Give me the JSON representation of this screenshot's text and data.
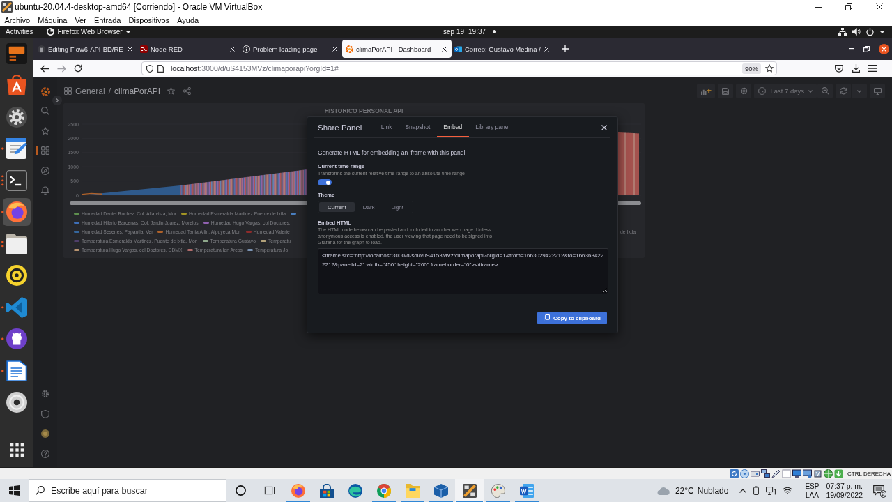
{
  "vbox": {
    "title": "ubuntu-20.04.4-desktop-amd64 [Corriendo] - Oracle VM VirtualBox",
    "menu": [
      "Archivo",
      "Máquina",
      "Ver",
      "Entrada",
      "Dispositivos",
      "Ayuda"
    ],
    "host_key": "CTRL DERECHA"
  },
  "ubuntu_bar": {
    "activities": "Activities",
    "app_menu": "Firefox Web Browser",
    "date": "sep 19",
    "time": "19:37"
  },
  "dock": [
    {
      "kind": "retro-term",
      "selected": false
    },
    {
      "kind": "software",
      "selected": false
    },
    {
      "kind": "settings",
      "selected": false
    },
    {
      "kind": "text-editor",
      "selected": false,
      "windows": [
        {
          "kind": "window"
        }
      ]
    },
    {
      "kind": "terminal",
      "selected": false,
      "windows": [
        {
          "kind": "window"
        },
        {
          "kind": "window"
        },
        {
          "kind": "window"
        }
      ]
    },
    {
      "kind": "firefox",
      "selected": true,
      "windows": [
        {
          "kind": "window"
        }
      ]
    },
    {
      "kind": "files",
      "selected": false,
      "windows": [
        {
          "kind": "window"
        },
        {
          "kind": "window"
        }
      ]
    },
    {
      "kind": "rhythmbox",
      "selected": false
    },
    {
      "kind": "vscode",
      "selected": false,
      "windows": [
        {
          "kind": "window"
        }
      ]
    },
    {
      "kind": "github",
      "selected": false,
      "windows": [
        {
          "kind": "window"
        }
      ]
    },
    {
      "kind": "writer",
      "selected": false,
      "windows": [
        {
          "kind": "window"
        }
      ]
    },
    {
      "kind": "disc",
      "selected": false
    },
    {
      "kind": "apps",
      "selected": false
    }
  ],
  "firefox": {
    "tabs": [
      {
        "kind": "github",
        "title": "Editing Flow6-API-BD/RE",
        "selected": false
      },
      {
        "kind": "node-red",
        "title": "Node-RED",
        "selected": false
      },
      {
        "kind": "info",
        "title": "Problem loading page",
        "selected": false
      },
      {
        "kind": "grafana",
        "title": "climaPorAPI - Dashboard",
        "selected": true
      },
      {
        "kind": "outlook",
        "title": "Correo: Gustavo Medina /",
        "selected": false
      }
    ],
    "url_host": "localhost",
    "url_path": ":3000/d/uS4153MVz/climaporapi?orgId=1#",
    "zoom": "90%"
  },
  "grafana": {
    "sidebar_top": [
      {
        "kind": "search",
        "selected": false
      },
      {
        "kind": "starred",
        "selected": false
      },
      {
        "kind": "dashboards",
        "selected": true
      },
      {
        "kind": "explore",
        "selected": false
      },
      {
        "kind": "alerting",
        "selected": false
      }
    ],
    "sidebar_bottom": [
      {
        "kind": "configuration",
        "selected": false
      },
      {
        "kind": "server-admin",
        "selected": false
      },
      {
        "kind": "profile",
        "selected": false
      },
      {
        "kind": "help",
        "selected": false
      }
    ],
    "breadcrumb": {
      "folder": "General",
      "separator": "/",
      "title": "climaPorAPI"
    },
    "time_picker": "Last 7 days",
    "panel": {
      "title": "HISTORICO PERSONAL API",
      "y_ticks": [
        "2500",
        "2000",
        "1500",
        "1000",
        "500",
        "0"
      ],
      "legend": [
        [
          {
            "kind": "series",
            "label": "Humedad Daniel Rochez. Col. Alta vista, Mor",
            "color": "#5e8f4e"
          },
          {
            "kind": "series",
            "label": "Humedad Esmeralda Martinez Puente de Ixtla",
            "color": "#a39524"
          },
          {
            "kind": "series",
            "color": "#4a7fc0"
          }
        ],
        [
          {
            "kind": "series",
            "label": "Humedad Hilario Barcenas. Col. Jardin Juarez, Morelos",
            "color": "#3e6fb8"
          },
          {
            "kind": "series",
            "label": "Humedad Hugo Vargas, col Doctores.",
            "color": "#9061b0"
          }
        ],
        [
          {
            "kind": "series",
            "label": "Humedad Sesenes. Papantla, Ver",
            "color": "#35679e"
          },
          {
            "kind": "series",
            "label": "Humedad Tania Ailin. Alpuyeca,Mor.",
            "color": "#b0622a"
          },
          {
            "kind": "series",
            "label": "Humedad Valerie",
            "color": "#8e2b2b"
          },
          {
            "kind": "fragment",
            "label": "de Ixtla"
          }
        ],
        [
          {
            "kind": "series",
            "label": "Temperatura Esmeralda Martinez. Puente de Ixtla, Mor.",
            "color": "#4f3f6a"
          },
          {
            "kind": "series",
            "label": "Temperatura Gustavo",
            "color": "#8fa88c"
          },
          {
            "kind": "series",
            "label": "Temperatu",
            "color": "#b3a27a"
          }
        ],
        [
          {
            "kind": "series",
            "label": "Temperatura Hugo Vargas, col Doctores. CDMX",
            "color": "#b8936f"
          },
          {
            "kind": "series",
            "label": "Temperatura Ian Arcos",
            "color": "#b06c6c"
          },
          {
            "kind": "series",
            "label": "Temperatura Jo",
            "color": "#7b93b3"
          }
        ]
      ]
    }
  },
  "share_panel": {
    "title": "Share Panel",
    "tabs": [
      {
        "label": "Link",
        "selected": false
      },
      {
        "label": "Snapshot",
        "selected": false
      },
      {
        "label": "Embed",
        "selected": true
      },
      {
        "label": "Library panel",
        "selected": false
      }
    ],
    "intro": "Generate HTML for embedding an iframe with this panel.",
    "time_range": {
      "label": "Current time range",
      "description": "Transforms the current relative time range to an absolute time range",
      "on": true
    },
    "theme": {
      "label": "Theme",
      "options": [
        {
          "label": "Current",
          "selected": true
        },
        {
          "label": "Dark",
          "selected": false
        },
        {
          "label": "Light",
          "selected": false
        }
      ]
    },
    "embed": {
      "label": "Embed HTML",
      "description": "The HTML code below can be pasted and included in another web page. Unless anonymous access is enabled, the user viewing that page need to be signed into Grafana for the graph to load.",
      "code": "<iframe src=\"http://localhost:3000/d-solo/uS4153MVz/climaporapi?orgId=1&from=1663029422212&to=1663634222212&panelId=2\" width=\"450\" height=\"200\" frameborder=\"0\"></iframe>"
    },
    "copy_button": "Copy to clipboard"
  },
  "taskbar": {
    "search_placeholder": "Escribe aquí para buscar",
    "apps": [
      {
        "kind": "firefox",
        "running": true,
        "selected": false
      },
      {
        "kind": "store",
        "running": false,
        "selected": false
      },
      {
        "kind": "edge",
        "running": false,
        "selected": false
      },
      {
        "kind": "chrome",
        "running": true,
        "selected": false
      },
      {
        "kind": "explorer",
        "running": true,
        "selected": false
      },
      {
        "kind": "virtualbox",
        "running": true,
        "selected": false
      },
      {
        "kind": "vm-window",
        "running": true,
        "selected": true
      },
      {
        "kind": "paint",
        "running": true,
        "selected": false
      },
      {
        "kind": "word",
        "running": true,
        "selected": false
      }
    ],
    "weather": {
      "temperature": "22°C",
      "condition": "Nublado"
    },
    "language": "ESP",
    "layout": "LAA",
    "time": "07:37 p. m.",
    "date": "19/09/2022",
    "notifications": "2"
  }
}
